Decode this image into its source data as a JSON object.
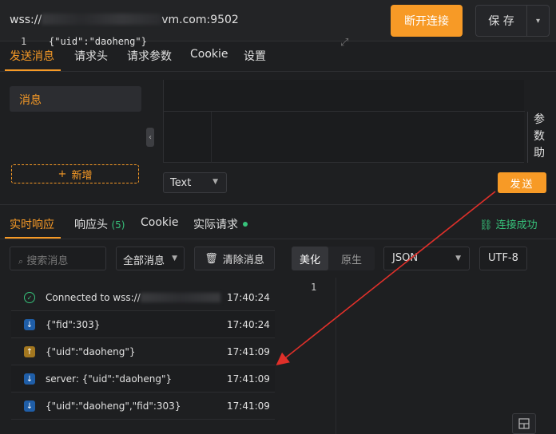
{
  "header": {
    "url_prefix": "wss://",
    "url_suffix": "vm.com:9502",
    "disconnect_label": "断开连接",
    "save_label": "保 存"
  },
  "request_tabs": [
    {
      "label": "发送消息",
      "active": true
    },
    {
      "label": "请求头",
      "active": false
    },
    {
      "label": "请求参数",
      "active": false
    },
    {
      "label": "Cookie",
      "active": false
    },
    {
      "label": "设置",
      "active": false
    }
  ],
  "message_list": {
    "items": [
      "消息"
    ],
    "add_label": "新增"
  },
  "editor": {
    "line_number": "1",
    "code": "{\"uid\":\"daoheng\"}",
    "param_helper_label": "参数助"
  },
  "send": {
    "type_value": "Text",
    "send_label": "发送"
  },
  "response_tabs": [
    {
      "label": "实时响应",
      "active": true
    },
    {
      "label": "响应头",
      "count": "(5)",
      "active": false
    },
    {
      "label": "Cookie",
      "active": false
    },
    {
      "label": "实际请求",
      "active": false
    }
  ],
  "connection_status": "连接成功",
  "filters": {
    "search_placeholder": "搜索消息",
    "filter_value": "全部消息",
    "clear_label": "清除消息"
  },
  "messages": [
    {
      "type": "connected",
      "text": "Connected to wss://",
      "time": "17:40:24"
    },
    {
      "type": "received",
      "text": "{\"fid\":303}",
      "time": "17:40:24"
    },
    {
      "type": "sent",
      "text": "{\"uid\":\"daoheng\"}",
      "time": "17:41:09"
    },
    {
      "type": "server",
      "text": "server: {\"uid\":\"daoheng\"}",
      "time": "17:41:09"
    },
    {
      "type": "received",
      "text": "{\"uid\":\"daoheng\",\"fid\":303}",
      "time": "17:41:09"
    }
  ],
  "viewer": {
    "format_tabs": [
      "美化",
      "原生"
    ],
    "language_value": "JSON",
    "encoding_value": "UTF-8",
    "line_number": "1"
  },
  "colors": {
    "accent": "#f79a26",
    "success": "#37c37b",
    "background": "#1e1f21",
    "annotation_arrow": "#e0302a"
  }
}
